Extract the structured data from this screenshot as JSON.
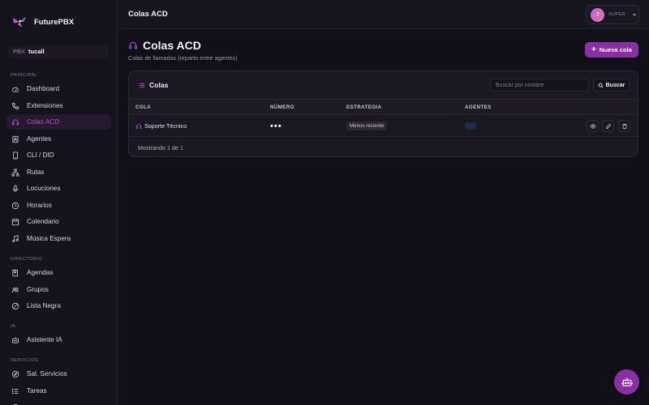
{
  "brand": {
    "name": "FuturePBX"
  },
  "pbx": {
    "key": "PBX",
    "value": "tucall"
  },
  "sidebar": {
    "sections": [
      {
        "label": "PRINCIPAL"
      },
      {
        "label": "DIRECTORIO"
      },
      {
        "label": "IA"
      },
      {
        "label": "SERVICIOS"
      }
    ],
    "items": [
      {
        "label": "Dashboard",
        "icon": "gauge-icon"
      },
      {
        "label": "Extensiones",
        "icon": "phone-icon"
      },
      {
        "label": "Colas ACD",
        "icon": "headset-icon",
        "active": true
      },
      {
        "label": "Agentes",
        "icon": "id-badge-icon"
      },
      {
        "label": "CLI / DID",
        "icon": "mobile-icon"
      },
      {
        "label": "Rutas",
        "icon": "sitemap-icon"
      },
      {
        "label": "Locuciones",
        "icon": "microphone-icon"
      },
      {
        "label": "Horarios",
        "icon": "clock-icon"
      },
      {
        "label": "Calendario",
        "icon": "calendar-icon"
      },
      {
        "label": "Música Espera",
        "icon": "music-icon"
      },
      {
        "label": "Agendas",
        "icon": "book-icon"
      },
      {
        "label": "Grupos",
        "icon": "users-icon"
      },
      {
        "label": "Lista Negra",
        "icon": "ban-icon"
      },
      {
        "label": "Asistente IA",
        "icon": "robot-icon"
      },
      {
        "label": "Sal. Servicios",
        "icon": "compass-icon"
      },
      {
        "label": "Tareas",
        "icon": "list-icon"
      }
    ]
  },
  "topbar": {
    "title": "Colas ACD",
    "user": {
      "initial": "?",
      "role": "SUPER"
    }
  },
  "page": {
    "title": "Colas ACD",
    "subtitle": "Colas de llamadas (reparto entre agentes)",
    "new_button": "Nueva cola"
  },
  "card": {
    "title": "Colas",
    "search_placeholder": "Buscar por nombre",
    "search_button": "Buscar",
    "columns": [
      "COLA",
      "NÚMERO",
      "ESTRATEGIA",
      "AGENTES"
    ],
    "rows": [
      {
        "cola": "Soporte Técnico",
        "numero": "•••",
        "estrategia": "Menos reciente",
        "agentes": "···"
      }
    ],
    "footer": "Mostrando 1 de 1"
  },
  "colors": {
    "accent": "#8a2fa6",
    "active_text": "#b454cf",
    "background": "#111018"
  }
}
